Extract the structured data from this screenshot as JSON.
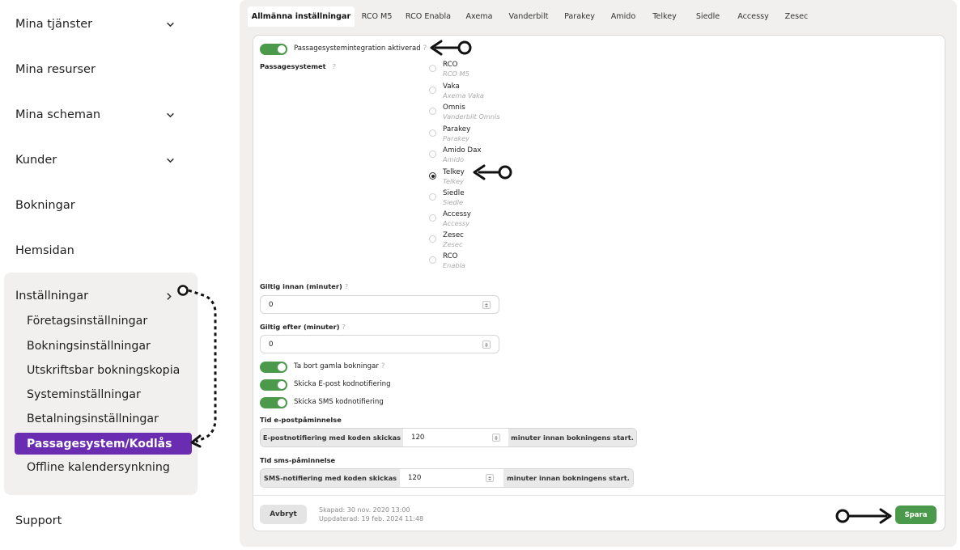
{
  "sidebar": {
    "items": [
      {
        "label": "Mina tjänster"
      },
      {
        "label": "Mina resurser"
      },
      {
        "label": "Mina scheman"
      },
      {
        "label": "Kunder"
      },
      {
        "label": "Bokningar"
      },
      {
        "label": "Hemsidan"
      },
      {
        "label": "Inställningar"
      },
      {
        "label": "Support"
      }
    ],
    "submenu": [
      {
        "label": "Företagsinställningar"
      },
      {
        "label": "Bokningsinställningar"
      },
      {
        "label": "Utskriftsbar bokningskopia"
      },
      {
        "label": "Systeminställningar"
      },
      {
        "label": "Betalningsinställningar"
      },
      {
        "label": "Passagesystem/Kodlås"
      },
      {
        "label": "Offline kalendersynkning"
      }
    ],
    "active_color": "#6a2cb0"
  },
  "tabs": [
    {
      "label": "Allmänna inställningar"
    },
    {
      "label": "RCO M5"
    },
    {
      "label": "RCO Enabla"
    },
    {
      "label": "Axema"
    },
    {
      "label": "Vanderbilt"
    },
    {
      "label": "Parakey"
    },
    {
      "label": "Amido"
    },
    {
      "label": "Telkey"
    },
    {
      "label": "Siedle"
    },
    {
      "label": "Accessy"
    },
    {
      "label": "Zesec"
    }
  ],
  "form": {
    "integration_toggle": "Passagesystemintegration aktiverad",
    "system_label": "Passagesystemet",
    "help_mark": "?",
    "options": [
      {
        "name": "RCO",
        "sub": "RCO M5"
      },
      {
        "name": "Vaka",
        "sub": "Axema Vaka"
      },
      {
        "name": "Omnis",
        "sub": "Vanderbilt Omnis"
      },
      {
        "name": "Parakey",
        "sub": "Parakey"
      },
      {
        "name": "Amido Dax",
        "sub": "Amido"
      },
      {
        "name": "Telkey",
        "sub": "Telkey"
      },
      {
        "name": "Siedle",
        "sub": "Siedle"
      },
      {
        "name": "Accessy",
        "sub": "Accessy"
      },
      {
        "name": "Zesec",
        "sub": "Zesec"
      },
      {
        "name": "RCO",
        "sub": "Enabla"
      }
    ],
    "selected_option": "Telkey",
    "valid_before_label": "Giltig innan (minuter)",
    "valid_before_value": "0",
    "valid_after_label": "Giltig efter (minuter)",
    "valid_after_value": "0",
    "toggle_remove_old": "Ta bort gamla bokningar",
    "toggle_email_code": "Skicka E-post kodnotifiering",
    "toggle_sms_code": "Skicka SMS kodnotifiering",
    "email_reminder_title": "Tid e-postpåminnelse",
    "email_prefix": "E-postnotifiering med koden skickas",
    "email_value": "120",
    "email_suffix": "minuter innan bokningens start.",
    "sms_reminder_title": "Tid sms-påminnelse",
    "sms_prefix": "SMS-notifiering med koden skickas",
    "sms_value": "120",
    "sms_suffix": "minuter innan bokningens start."
  },
  "footer": {
    "cancel_label": "Avbryt",
    "created": "Skapad: 30 nov. 2020 13:00",
    "updated": "Uppdaterad: 19 feb. 2024 11:48",
    "save_label": "Spara"
  },
  "colors": {
    "toggle_on": "#4b9a4b",
    "save_button": "#4b9a4b",
    "panel_bg": "#f1f0ee"
  }
}
